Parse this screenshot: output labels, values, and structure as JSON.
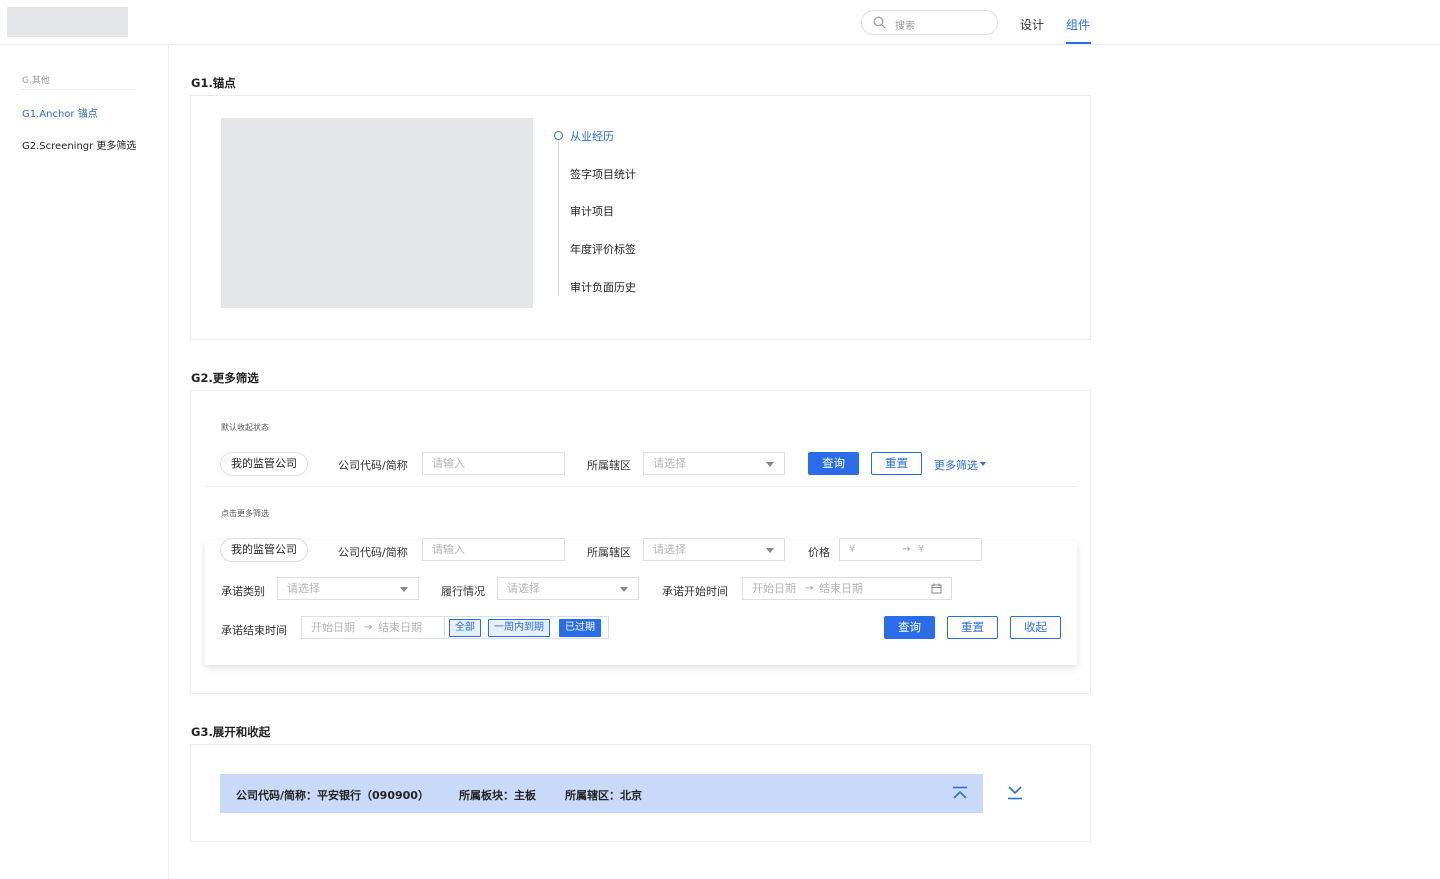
{
  "header": {
    "search_placeholder": "搜索",
    "nav": [
      "设计",
      "组件"
    ],
    "active_nav": "组件"
  },
  "sidebar": {
    "group": "G.其他",
    "items": [
      {
        "label": "G1.Anchor 锚点",
        "active": true
      },
      {
        "label": "G2.Screeningr 更多筛选",
        "active": false
      }
    ]
  },
  "g1": {
    "title": "G1.锚点",
    "anchors": [
      "从业经历",
      "签字项目统计",
      "审计项目",
      "年度评价标签",
      "审计负面历史"
    ]
  },
  "g2": {
    "title": "G2.更多筛选",
    "collapsed_note": "默认收起状态",
    "expanded_note": "点击更多筛选",
    "my_company": "我的监管公司",
    "company_code_label": "公司代码/简称",
    "input_placeholder": "请输入",
    "region_label": "所属辖区",
    "select_placeholder": "请选择",
    "query": "查询",
    "reset": "重置",
    "more_filter": "更多筛选",
    "collapse": "收起",
    "price_label": "价格",
    "price_symbol": "¥",
    "price_arrow": "→",
    "promise_type_label": "承诺类别",
    "performance_label": "履行情况",
    "promise_start_label": "承诺开始时间",
    "promise_end_label": "承诺结束时间",
    "start_date": "开始日期",
    "end_date": "结束日期",
    "date_arrow": "→",
    "quick_tags": [
      "全部",
      "一周内到期",
      "已过期"
    ]
  },
  "g3": {
    "title": "G3.展开和收起",
    "company": "公司代码/简称：平安银行（090900）",
    "board": "所属板块：主板",
    "region": "所属辖区：北京"
  },
  "colors": {
    "accent": "#2a6de8",
    "bar": "#c9daf8",
    "placeholder": "#e4e6ea"
  }
}
